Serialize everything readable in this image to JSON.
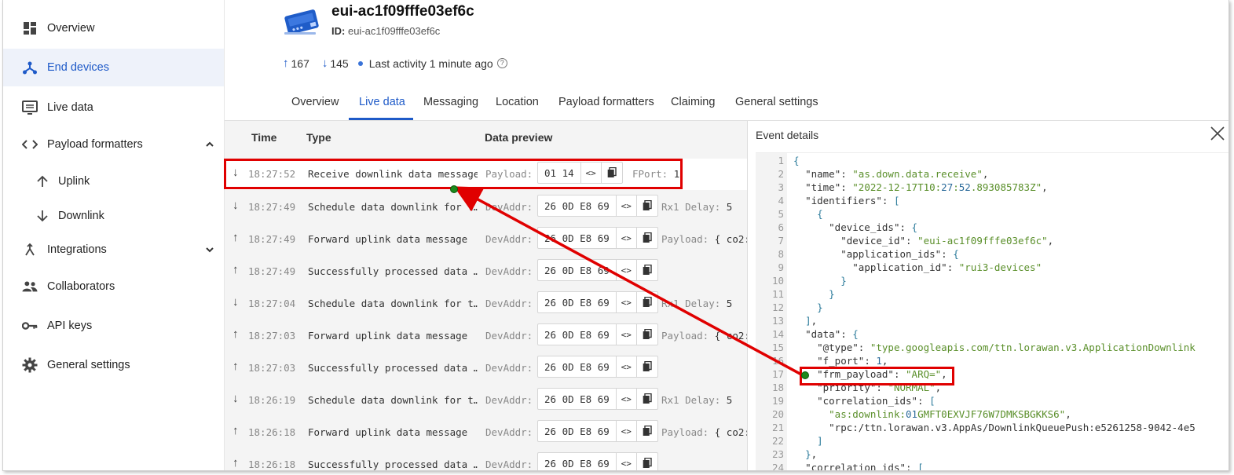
{
  "sidebar": {
    "items": [
      {
        "label": "Overview",
        "icon": "grid-icon"
      },
      {
        "label": "End devices",
        "icon": "devices-icon"
      },
      {
        "label": "Live data",
        "icon": "monitor-icon"
      },
      {
        "label": "Payload formatters",
        "icon": "code-icon"
      },
      {
        "label": "Uplink",
        "icon": "arrow-up-icon"
      },
      {
        "label": "Downlink",
        "icon": "arrow-down-icon"
      },
      {
        "label": "Integrations",
        "icon": "integrations-icon"
      },
      {
        "label": "Collaborators",
        "icon": "people-icon"
      },
      {
        "label": "API keys",
        "icon": "key-icon"
      },
      {
        "label": "General settings",
        "icon": "gear-icon"
      }
    ]
  },
  "device": {
    "title": "eui-ac1f09fffe03ef6c",
    "id_label": "ID:",
    "id_value": "eui-ac1f09fffe03ef6c",
    "uplink_count": "167",
    "downlink_count": "145",
    "last_activity": "Last activity 1 minute ago"
  },
  "tabs": [
    "Overview",
    "Live data",
    "Messaging",
    "Location",
    "Payload formatters",
    "Claiming",
    "General settings"
  ],
  "table": {
    "headers": {
      "time": "Time",
      "type": "Type",
      "preview": "Data preview"
    },
    "rows": [
      {
        "dir": "↓",
        "time": "18:27:52",
        "type": "Receive downlink data message",
        "label": "Payload:",
        "hex": "01 14",
        "extra_label": "FPort:",
        "extra_value": "1"
      },
      {
        "dir": "↓",
        "time": "18:27:49",
        "type": "Schedule data downlink for t…",
        "label": "DevAddr:",
        "hex": "26 0D E8 69",
        "extra_label": "Rx1 Delay:",
        "extra_value": "5"
      },
      {
        "dir": "↑",
        "time": "18:27:49",
        "type": "Forward uplink data message",
        "label": "DevAddr:",
        "hex": "26 0D E8 69",
        "extra_label": "Payload:",
        "extra_value": "{ co2:"
      },
      {
        "dir": "↑",
        "time": "18:27:49",
        "type": "Successfully processed data …",
        "label": "DevAddr:",
        "hex": "26 0D E8 69",
        "extra_label": "",
        "extra_value": ""
      },
      {
        "dir": "↓",
        "time": "18:27:04",
        "type": "Schedule data downlink for t…",
        "label": "DevAddr:",
        "hex": "26 0D E8 69",
        "extra_label": "Rx1 Delay:",
        "extra_value": "5"
      },
      {
        "dir": "↑",
        "time": "18:27:03",
        "type": "Forward uplink data message",
        "label": "DevAddr:",
        "hex": "26 0D E8 69",
        "extra_label": "Payload:",
        "extra_value": "{ co2:"
      },
      {
        "dir": "↑",
        "time": "18:27:03",
        "type": "Successfully processed data …",
        "label": "DevAddr:",
        "hex": "26 0D E8 69",
        "extra_label": "",
        "extra_value": ""
      },
      {
        "dir": "↓",
        "time": "18:26:19",
        "type": "Schedule data downlink for t…",
        "label": "DevAddr:",
        "hex": "26 0D E8 69",
        "extra_label": "Rx1 Delay:",
        "extra_value": "5"
      },
      {
        "dir": "↑",
        "time": "18:26:18",
        "type": "Forward uplink data message",
        "label": "DevAddr:",
        "hex": "26 0D E8 69",
        "extra_label": "Payload:",
        "extra_value": "{ co2:"
      },
      {
        "dir": "↑",
        "time": "18:26:18",
        "type": "Successfully processed data …",
        "label": "DevAddr:",
        "hex": "26 0D E8 69",
        "extra_label": "",
        "extra_value": ""
      }
    ]
  },
  "details": {
    "title": "Event details",
    "lines": [
      "{",
      "  \"name\": \"as.down.data.receive\",",
      "  \"time\": \"2022-12-17T10:27:52.893085783Z\",",
      "  \"identifiers\": [",
      "    {",
      "      \"device_ids\": {",
      "        \"device_id\": \"eui-ac1f09fffe03ef6c\",",
      "        \"application_ids\": {",
      "          \"application_id\": \"rui3-devices\"",
      "        }",
      "      }",
      "    }",
      "  ],",
      "  \"data\": {",
      "    \"@type\": \"type.googleapis.com/ttn.lorawan.v3.ApplicationDownlink",
      "    \"f_port\": 1,",
      "    \"frm_payload\": \"ARQ=\",",
      "    \"priority\": \"NORMAL\",",
      "    \"correlation_ids\": [",
      "      \"as:downlink:01GMFT0EXVJF76W7DMKSBGKKS6\",",
      "      \"rpc:/ttn.lorawan.v3.AppAs/DownlinkQueuePush:e5261258-9042-4e5",
      "    ]",
      "  },",
      "  \"correlation_ids\": ["
    ]
  },
  "colors": {
    "accent": "#1e5ac8",
    "annotation": "#e00000",
    "connector_dot": "#1d8a1d"
  }
}
